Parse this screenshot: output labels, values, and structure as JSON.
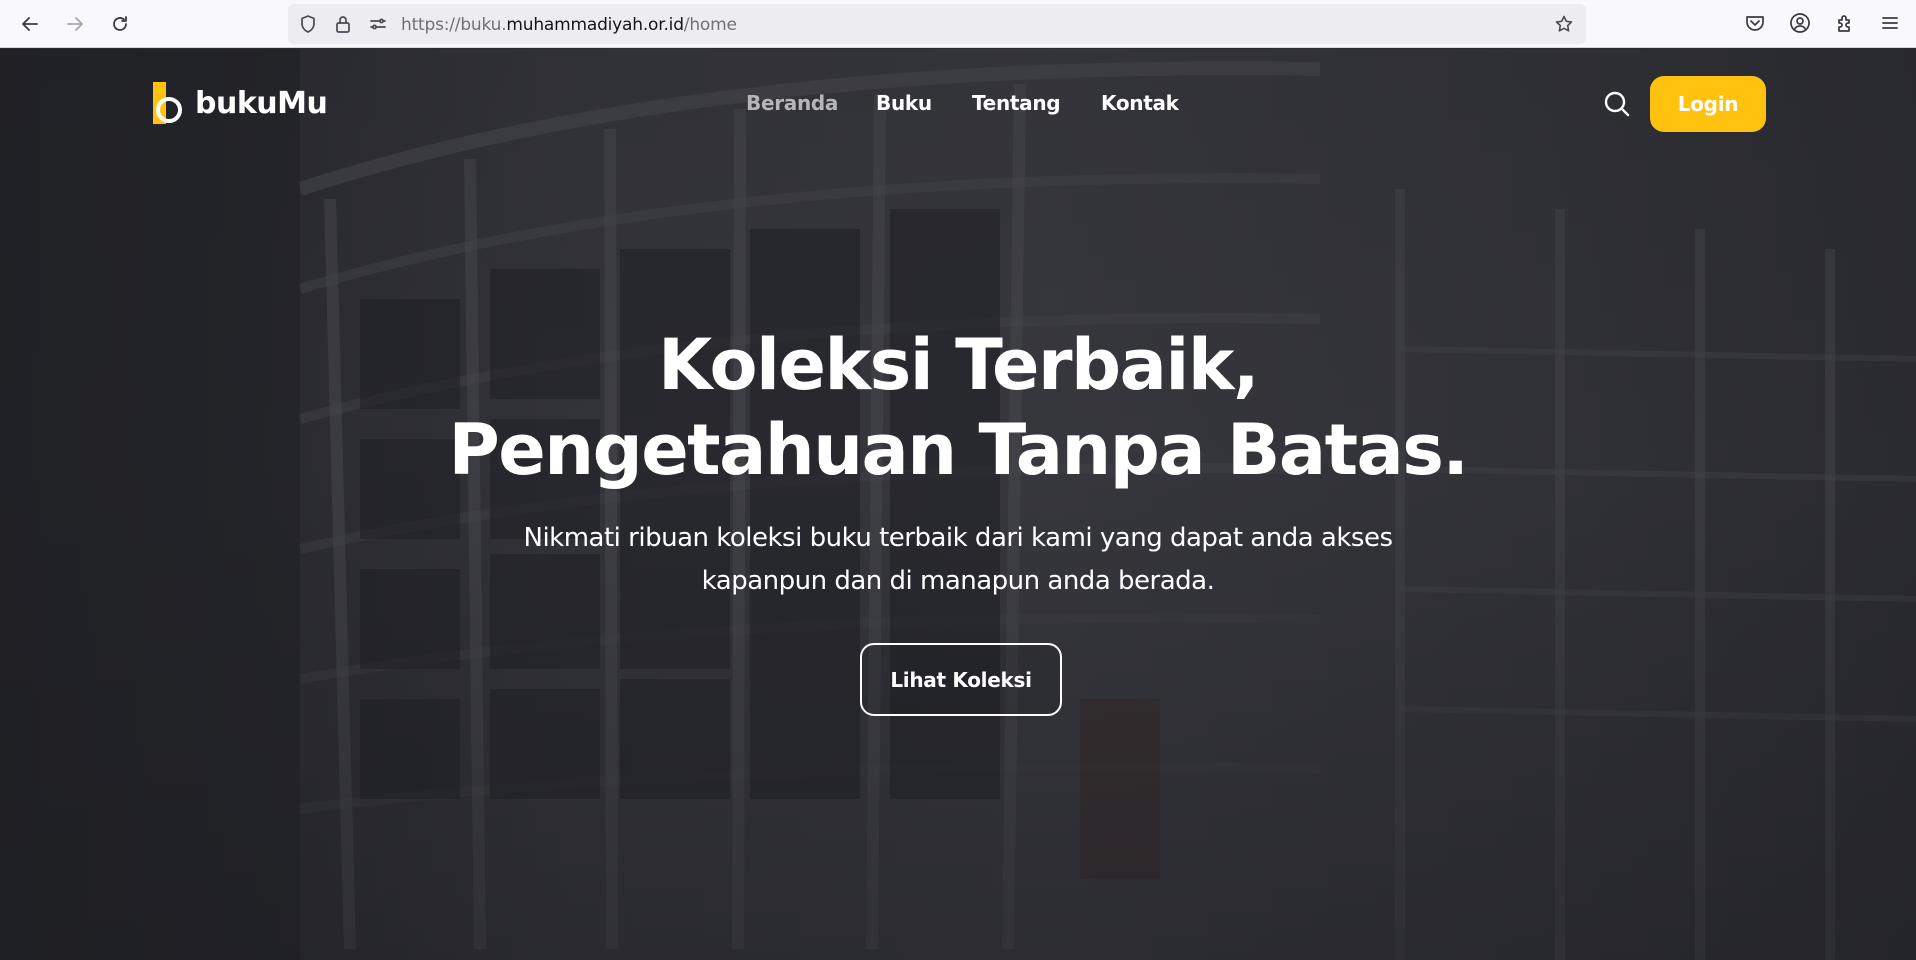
{
  "browser": {
    "url_prefix": "https://buku.",
    "url_host": "muhammadiyah.or.id",
    "url_suffix": "/home"
  },
  "site": {
    "logo_text": "bukuMu",
    "brand_color": "#ffc20e",
    "nav": [
      {
        "label": "Beranda",
        "active": true
      },
      {
        "label": "Buku"
      },
      {
        "label": "Tentang"
      },
      {
        "label": "Kontak"
      }
    ],
    "login_label": "Login"
  },
  "hero": {
    "title_line1": "Koleksi Terbaik,",
    "title_line2": "Pengetahuan Tanpa Batas.",
    "subtitle_line1": "Nikmati ribuan koleksi buku terbaik dari kami yang dapat anda akses",
    "subtitle_line2": "kapanpun dan di manapun anda berada.",
    "cta_label": "Lihat Koleksi"
  }
}
